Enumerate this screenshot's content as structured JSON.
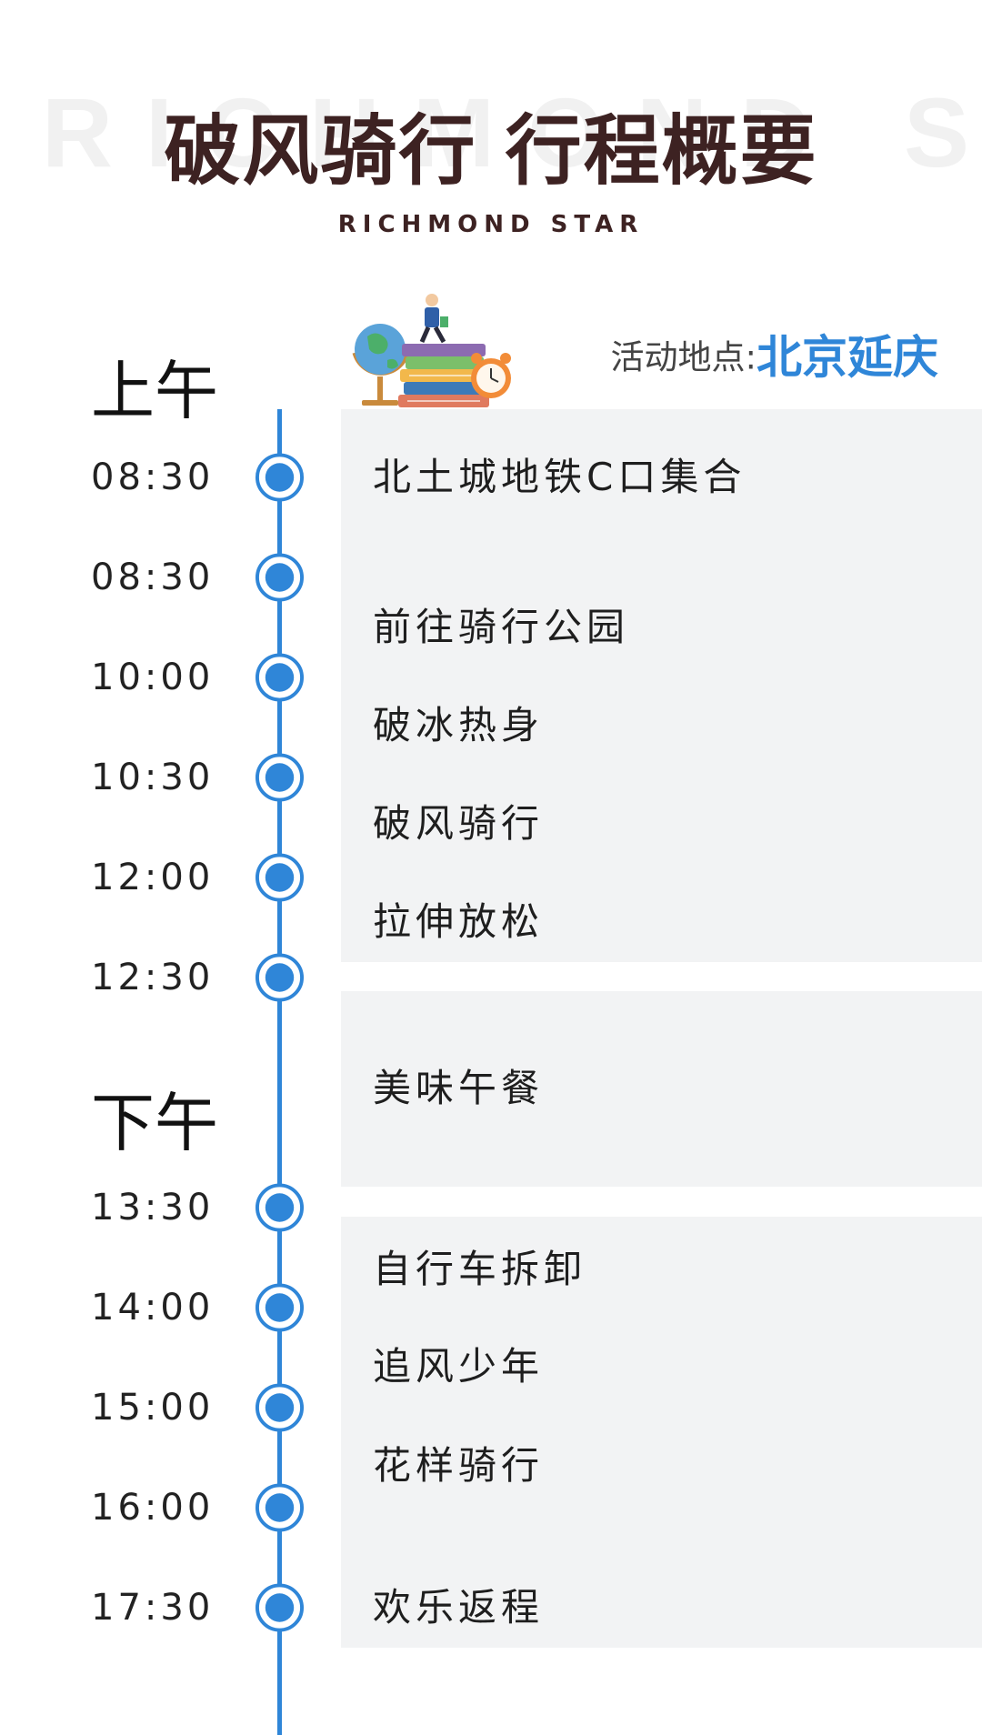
{
  "header": {
    "watermark": "RICHMOND STAR",
    "title": "破风骑行 行程概要",
    "subtitle": "RICHMOND STAR"
  },
  "location": {
    "label": "活动地点:",
    "value": "北京延庆"
  },
  "sections": {
    "morning": "上午",
    "afternoon": "下午"
  },
  "timeline": [
    {
      "time": "08:30"
    },
    {
      "time": "08:30"
    },
    {
      "time": "10:00"
    },
    {
      "time": "10:30"
    },
    {
      "time": "12:00"
    },
    {
      "time": "12:30"
    },
    {
      "time": "13:30"
    },
    {
      "time": "14:00"
    },
    {
      "time": "15:00"
    },
    {
      "time": "16:00"
    },
    {
      "time": "17:30"
    }
  ],
  "activities": [
    "北土城地铁C口集合",
    "前往骑行公园",
    "破冰热身",
    "破风骑行",
    "拉伸放松",
    "美味午餐",
    "自行车拆卸",
    "追风少年",
    "花样骑行",
    "欢乐返程"
  ],
  "colors": {
    "accent": "#2f86d8",
    "title": "#3d2222",
    "panel": "#f2f3f4"
  },
  "icons": {
    "illustration": "person-on-books-globe-clock-illustration",
    "node": "timeline-dot-icon"
  }
}
